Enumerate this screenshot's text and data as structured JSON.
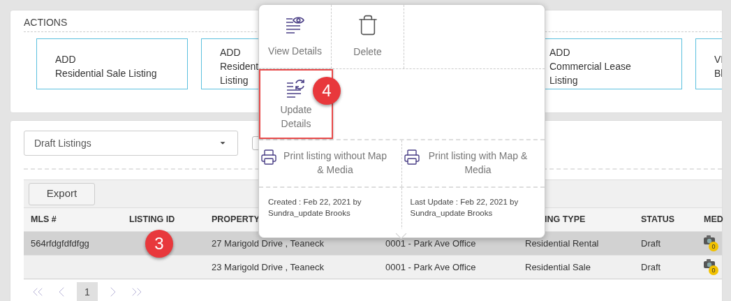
{
  "actions": {
    "title": "ACTIONS",
    "cards": [
      {
        "lines": [
          "ADD",
          "Residential Sale Listing"
        ]
      },
      {
        "lines": [
          "ADD",
          "Resident",
          "Listing"
        ]
      },
      {
        "lines": [
          "ADD",
          "Commercial Lease",
          "Listing"
        ]
      },
      {
        "lines": [
          "VI",
          "Bl"
        ]
      }
    ]
  },
  "filter": {
    "value": "Draft Listings",
    "checked": false
  },
  "toolbar": {
    "export": "Export"
  },
  "table": {
    "columns": [
      "MLS #",
      "LISTING ID",
      "PROPERTY",
      "",
      "ING TYPE",
      "STATUS",
      "MED"
    ],
    "rows": [
      {
        "selected": true,
        "cells": [
          "564rfdgfdfdfgg",
          "",
          "27 Marigold Drive , Teaneck",
          "0001 - Park Ave Office",
          "Residential Rental",
          "Draft"
        ],
        "media": "0"
      },
      {
        "selected": false,
        "cells": [
          "",
          "",
          "23 Marigold Drive , Teaneck",
          "0001 - Park Ave Office",
          "Residential Sale",
          "Draft"
        ],
        "media": "0"
      }
    ]
  },
  "pagination": {
    "pages": [
      {
        "label": "1",
        "selected": true
      }
    ]
  },
  "popup": {
    "actions": [
      {
        "kind": "view",
        "label": "View Details",
        "highlighted": false
      },
      {
        "kind": "delete",
        "label": "Delete",
        "highlighted": false
      },
      {
        "kind": "update",
        "label": "Update Details",
        "highlighted": true
      }
    ],
    "prints": [
      "Print listing without Map & Media",
      "Print listing with Map & Media"
    ],
    "created": "Created : Feb 22, 2021 by Sundra_update Brooks",
    "last_update": "Last Update : Feb 22, 2021 by Sundra_update Brooks"
  },
  "callouts": [
    {
      "label": "3"
    },
    {
      "label": "4"
    }
  ]
}
